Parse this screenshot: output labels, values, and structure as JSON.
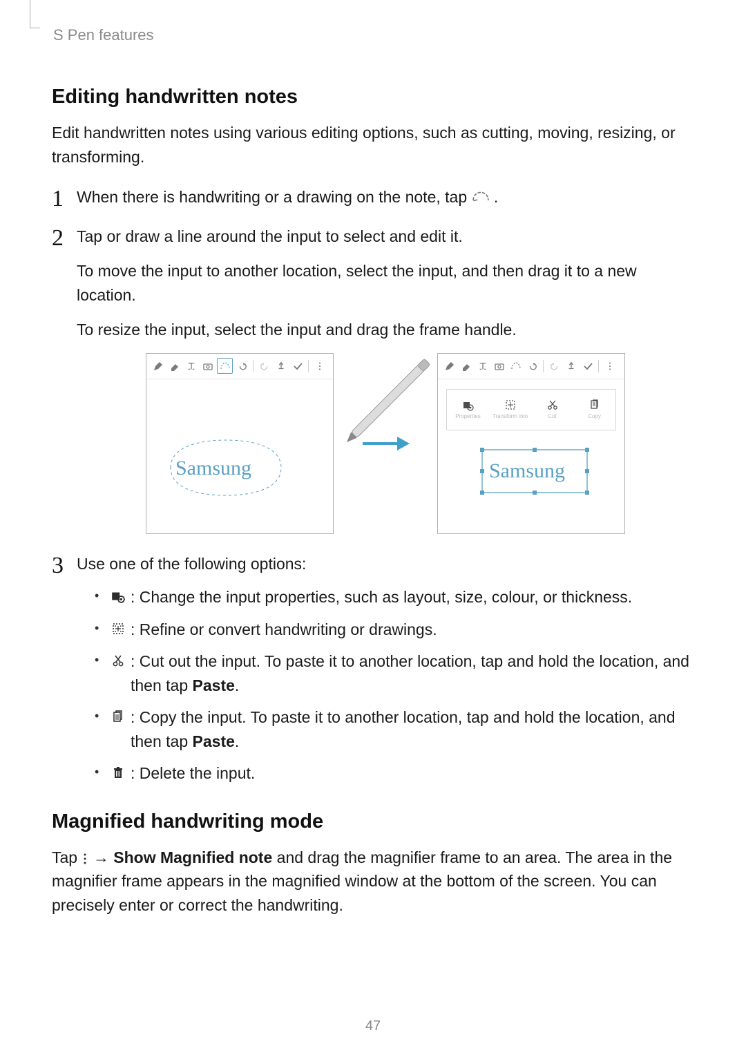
{
  "breadcrumb": "S Pen features",
  "section1_heading": "Editing handwritten notes",
  "intro1": "Edit handwritten notes using various editing options, such as cutting, moving, resizing, or transforming.",
  "steps": [
    {
      "num": "1",
      "lines": [
        "When there is handwriting or a drawing on the note, tap ",
        "."
      ]
    },
    {
      "num": "2",
      "lines": [
        "Tap or draw a line around the input to select and edit it.",
        "To move the input to another location, select the input, and then drag it to a new location.",
        "To resize the input, select the input and drag the frame handle."
      ]
    },
    {
      "num": "3",
      "intro": "Use one of the following options:",
      "bullets": [
        {
          "icon": "properties",
          "text": " : Change the input properties, such as layout, size, colour, or thickness."
        },
        {
          "icon": "transform",
          "text": " : Refine or convert handwriting or drawings."
        },
        {
          "icon": "cut",
          "text": " : Cut out the input. To paste it to another location, tap and hold the location, and then tap ",
          "bold": "Paste",
          "tail": "."
        },
        {
          "icon": "copy",
          "text": " : Copy the input. To paste it to another location, tap and hold the location, and then tap ",
          "bold": "Paste",
          "tail": "."
        },
        {
          "icon": "delete",
          "text": " : Delete the input."
        }
      ]
    }
  ],
  "section2_heading": "Magnified handwriting mode",
  "mag_pre": "Tap ",
  "mag_arrow": " → ",
  "mag_bold": "Show Magnified note",
  "mag_post": " and drag the magnifier frame to an area. The area in the magnifier frame appears in the magnified window at the bottom of the screen. You can precisely enter or correct the handwriting.",
  "subtoolbar_labels": {
    "properties": "Properties",
    "transform": "Transform into",
    "cut": "Cut",
    "copy": "Copy"
  },
  "figure_word": "Samsung",
  "page_number": "47"
}
